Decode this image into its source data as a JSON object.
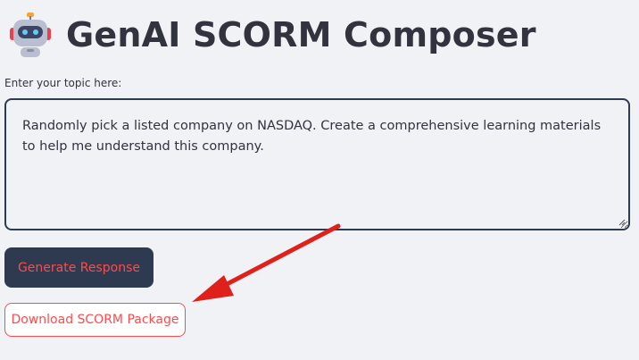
{
  "app": {
    "title": "GenAI SCORM Composer",
    "logo_icon": "robot-icon"
  },
  "form": {
    "topic_label": "Enter your topic here:",
    "topic_value": "Randomly pick a listed company on NASDAQ. Create a comprehensive learning materials to help me understand this company."
  },
  "buttons": {
    "generate_label": "Generate Response",
    "download_label": "Download SCORM Package"
  },
  "annotation": {
    "arrow_icon": "red-arrow-icon",
    "arrow_color": "#e0201b"
  },
  "colors": {
    "accent": "#ff4b4b",
    "dark_button": "#2d3a4f",
    "background": "#f0f2f6",
    "text": "#31333f"
  }
}
